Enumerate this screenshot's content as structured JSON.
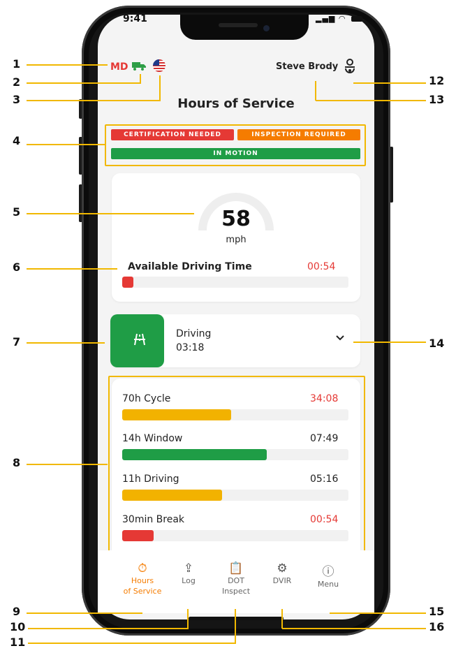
{
  "status_bar": {
    "time": "9:41"
  },
  "header": {
    "state_code": "MD",
    "truck_icon": "truck-icon",
    "flag_icon": "us-flag-icon",
    "user_name": "Steve Brody",
    "user_icon": "driver-profile-icon",
    "title": "Hours of Service"
  },
  "badges": {
    "certification": "CERTIFICATION NEEDED",
    "inspection": "INSPECTION REQUIRED",
    "motion": "IN MOTION"
  },
  "speed": {
    "value": "58",
    "unit": "mph",
    "available_label": "Available Driving Time",
    "available_value": "00:54",
    "available_fraction": 0.05
  },
  "duty_status": {
    "label": "Driving",
    "time": "03:18",
    "icon": "road-icon"
  },
  "limits": [
    {
      "label": "70h Cycle",
      "value": "34:08",
      "fraction": 0.48,
      "color": "#f2b200",
      "value_color": "#e53935"
    },
    {
      "label": "14h Window",
      "value": "07:49",
      "fraction": 0.64,
      "color": "#1f9d46",
      "value_color": "#222222"
    },
    {
      "label": "11h Driving",
      "value": "05:16",
      "fraction": 0.44,
      "color": "#f2b200",
      "value_color": "#222222"
    },
    {
      "label": "30min Break",
      "value": "00:54",
      "fraction": 0.14,
      "color": "#e53935",
      "value_color": "#e53935"
    }
  ],
  "nav": {
    "hos": "Hours of Service",
    "log": "Log",
    "dot_line1": "DOT",
    "dot_line2": "Inspect",
    "dvir": "DVIR",
    "menu": "Menu",
    "hos_line1": "Hours",
    "hos_line2": "of Service"
  },
  "callouts": [
    "1",
    "2",
    "3",
    "4",
    "5",
    "6",
    "7",
    "8",
    "9",
    "10",
    "11",
    "12",
    "13",
    "14",
    "15",
    "16"
  ],
  "colors": {
    "accent": "#f1b800",
    "green": "#1f9d46",
    "red": "#e53935",
    "orange": "#f57c00",
    "active_nav": "#f57c00"
  }
}
